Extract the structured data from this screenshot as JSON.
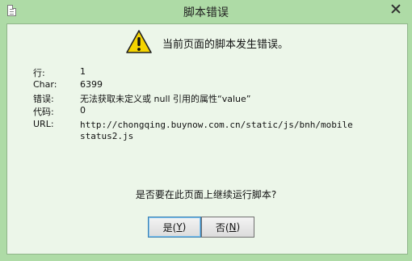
{
  "window": {
    "title": "脚本错误",
    "icon": "document-icon"
  },
  "message": {
    "heading": "当前页面的脚本发生错误。",
    "icon": "warning-icon",
    "icon_colors": {
      "triangle": "#f5d400",
      "outline": "#222222",
      "mark": "#111111"
    }
  },
  "details": {
    "line_label": "行:",
    "line_value": "1",
    "char_label": "Char:",
    "char_value": "6399",
    "error_label": "错误:",
    "error_value": "无法获取未定义或 null 引用的属性“value”",
    "code_label": "代码:",
    "code_value": "0",
    "url_label": "URL:",
    "url_value": "http://chongqing.buynow.com.cn/static/js/bnh/mobilestatus2.js"
  },
  "prompt": {
    "question": "是否要在此页面上继续运行脚本?"
  },
  "buttons": {
    "yes_text": "是(",
    "yes_key": "Y",
    "yes_end": ")",
    "no_text": "否(",
    "no_key": "N",
    "no_end": ")"
  },
  "colors": {
    "frame": "#aedba6",
    "content_background": "#ecf6e9",
    "default_button_border": "#3c7fb1"
  }
}
